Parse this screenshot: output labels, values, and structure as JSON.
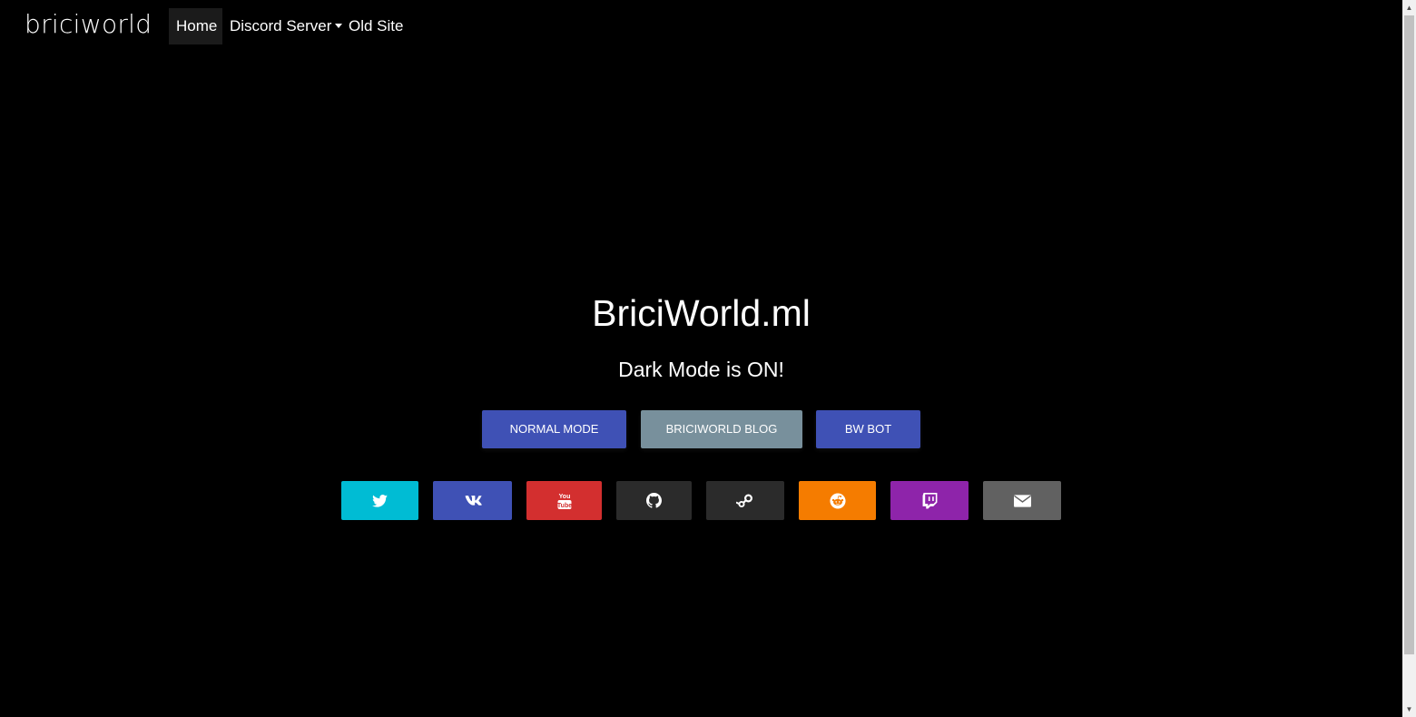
{
  "navbar": {
    "brand": "briciworld",
    "items": [
      {
        "label": "Home",
        "active": true
      },
      {
        "label": "Discord Server",
        "dropdown": true
      },
      {
        "label": "Old Site"
      }
    ]
  },
  "hero": {
    "title": "BriciWorld.ml",
    "subtitle": "Dark Mode is ON!"
  },
  "buttons": {
    "normal_mode": "NORMAL MODE",
    "blog": "BRICIWORLD BLOG",
    "bot": "BW BOT"
  },
  "social": [
    {
      "icon": "twitter-icon",
      "color": "#00bcd4"
    },
    {
      "icon": "vk-icon",
      "color": "#3f51b5"
    },
    {
      "icon": "youtube-icon",
      "color": "#d32f2f"
    },
    {
      "icon": "github-icon",
      "color": "#2b2b2b"
    },
    {
      "icon": "steam-icon",
      "color": "#2b2b2b"
    },
    {
      "icon": "reddit-icon",
      "color": "#f57c00"
    },
    {
      "icon": "twitch-icon",
      "color": "#8e24aa"
    },
    {
      "icon": "envelope-icon",
      "color": "#616161"
    }
  ],
  "colors": {
    "background": "#000000",
    "primary": "#3f51b5",
    "secondary": "#78909c"
  }
}
